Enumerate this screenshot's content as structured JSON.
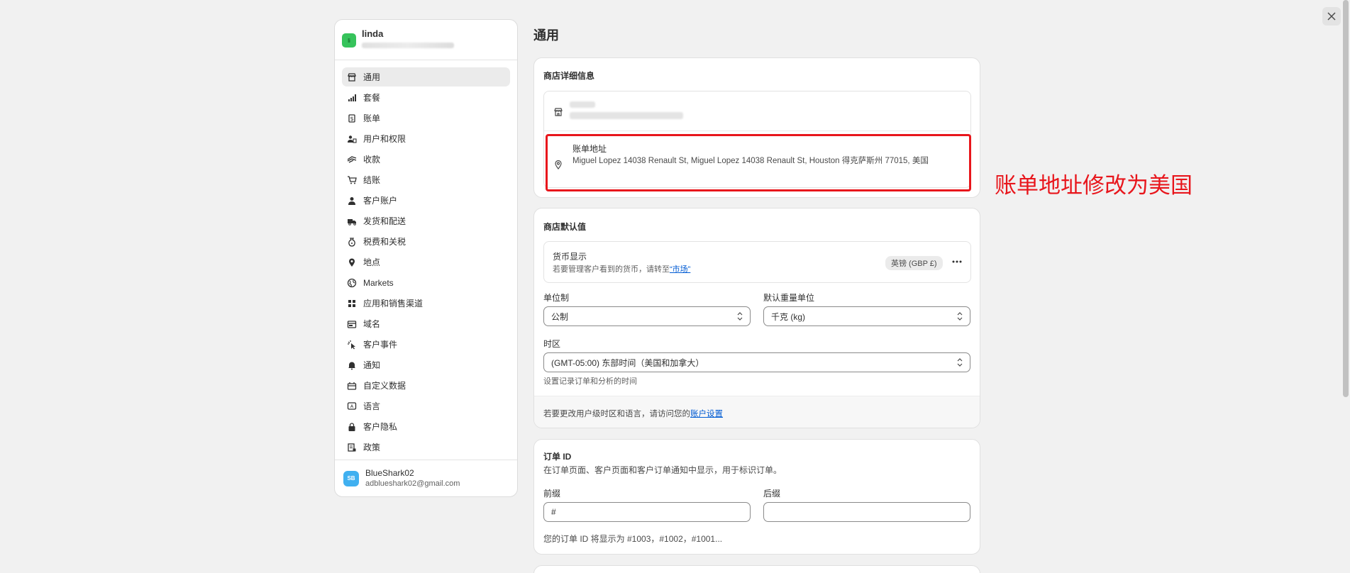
{
  "store": {
    "name": "linda",
    "initials": "li"
  },
  "sidebar": {
    "items": [
      {
        "label": "通用",
        "icon": "store-icon",
        "active": true
      },
      {
        "label": "套餐",
        "icon": "plan-icon"
      },
      {
        "label": "账单",
        "icon": "billing-icon"
      },
      {
        "label": "用户和权限",
        "icon": "users-icon"
      },
      {
        "label": "收款",
        "icon": "payments-icon"
      },
      {
        "label": "结账",
        "icon": "cart-icon"
      },
      {
        "label": "客户账户",
        "icon": "person-icon"
      },
      {
        "label": "发货和配送",
        "icon": "delivery-icon"
      },
      {
        "label": "税费和关税",
        "icon": "tax-icon"
      },
      {
        "label": "地点",
        "icon": "location-icon"
      },
      {
        "label": "Markets",
        "icon": "globe-icon"
      },
      {
        "label": "应用和销售渠道",
        "icon": "apps-icon"
      },
      {
        "label": "域名",
        "icon": "domain-icon"
      },
      {
        "label": "客户事件",
        "icon": "cursor-icon"
      },
      {
        "label": "通知",
        "icon": "bell-icon"
      },
      {
        "label": "自定义数据",
        "icon": "data-icon"
      },
      {
        "label": "语言",
        "icon": "language-icon"
      },
      {
        "label": "客户隐私",
        "icon": "lock-icon"
      },
      {
        "label": "政策",
        "icon": "policy-icon"
      }
    ]
  },
  "user": {
    "initials": "SB",
    "name": "BlueShark02",
    "email": "adblueshark02@gmail.com"
  },
  "page": {
    "title": "通用"
  },
  "store_details": {
    "title": "商店详细信息",
    "billing_label": "账单地址",
    "billing_address": "Miguel Lopez 14038 Renault St, Miguel Lopez 14038 Renault St, Houston 得克萨斯州 77015, 美国"
  },
  "store_defaults": {
    "title": "商店默认值",
    "currency_label": "货币显示",
    "currency_hint": "若要管理客户看到的货币，请转至",
    "currency_link": "“市场”",
    "currency_badge": "英镑 (GBP £)",
    "unit_system_label": "单位制",
    "unit_system_value": "公制",
    "weight_unit_label": "默认重量单位",
    "weight_unit_value": "千克 (kg)",
    "timezone_label": "时区",
    "timezone_value": "(GMT-05:00) 东部时间（美国和加拿大）",
    "timezone_hint": "设置记录订单和分析的时间",
    "footer_text": "若要更改用户级时区和语言，请访问您的",
    "footer_link": "账户设置"
  },
  "order_id": {
    "title": "订单 ID",
    "description": "在订单页面、客户页面和客户订单通知中显示，用于标识订单。",
    "prefix_label": "前缀",
    "prefix_value": "#",
    "suffix_label": "后缀",
    "suffix_value": "",
    "preview": "您的订单 ID 将显示为 #1003，#1002，#1001..."
  },
  "annotation": {
    "text": "账单地址修改为美国",
    "color": "#e8161c"
  },
  "colors": {
    "accent_link": "#005bd3",
    "store_avatar": "#36c35b",
    "user_avatar": "#40b0f0"
  }
}
